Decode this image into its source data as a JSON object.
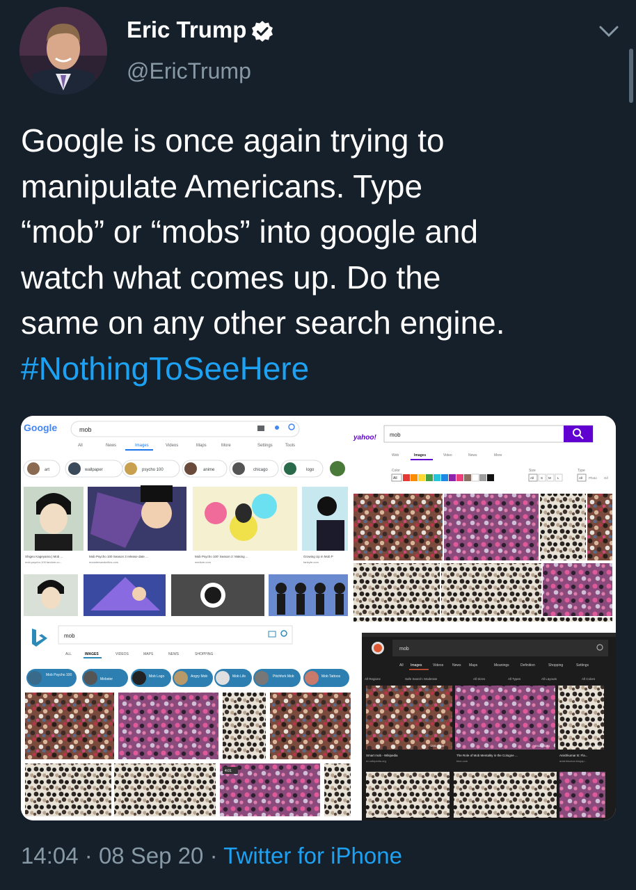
{
  "author": {
    "name": "Eric Trump",
    "handle": "@EricTrump",
    "verified": true
  },
  "tweet": {
    "lines": [
      "Google is once again trying to",
      "manipulate Americans. Type",
      "“mob” or “mobs” into google and",
      "watch what comes up. Do the",
      "same on any other search engine."
    ],
    "hashtag": "#NothingToSeeHere"
  },
  "meta": {
    "time": "14:04",
    "dot1": "·",
    "date": "08 Sep 20",
    "dot2": "·",
    "source": "Twitter for iPhone"
  },
  "screenshots": {
    "google": {
      "logo": "Google",
      "query": "mob",
      "tabs": [
        "All",
        "News",
        "Images",
        "Videos",
        "Maps",
        "More"
      ],
      "tools": [
        "Settings",
        "Tools"
      ],
      "chips": [
        "art",
        "wallpaper",
        "psycho 100",
        "anime",
        "chicago",
        "logo"
      ],
      "captions": [
        "Shigeo Kageyama | Mob ...",
        "Mob Psycho 100 Season 3 release date ...",
        "Mob Psycho 100' Season 2: Making ...",
        "Growing Up in Mob P"
      ],
      "domains": [
        "mob-psycho-100.fandom.co...",
        "monstersandcritics.com",
        "medium.com",
        "fanbyte.com"
      ]
    },
    "yahoo": {
      "logo": "yahoo!",
      "query": "mob",
      "tabs": [
        "Web",
        "Images",
        "Video",
        "News",
        "More"
      ],
      "filters": [
        "Color",
        "Size",
        "Type"
      ],
      "all": "All",
      "sizes": [
        "All",
        "S",
        "M",
        "L"
      ],
      "types": [
        "All",
        "Photo",
        "Gif"
      ]
    },
    "bing": {
      "query": "mob",
      "tabs": [
        "ALL",
        "IMAGES",
        "VIDEOS",
        "MAPS",
        "NEWS",
        "SHOPPING"
      ],
      "chips": [
        "Mob Psycho 100",
        "Mobster",
        "Mob Logo",
        "Angry Mob",
        "Mob Life",
        "Pitchfork Mob",
        "Mob Tattoos"
      ],
      "badge": "4:01"
    },
    "ddg": {
      "query": "mob",
      "tabs": [
        "All",
        "Images",
        "Videos",
        "News",
        "Maps",
        "Meanings",
        "Definition",
        "Shopping",
        "Settings"
      ],
      "filters": [
        "All Regions",
        "Safe Search: Moderate",
        "All Sizes",
        "All Types",
        "All Layouts",
        "All Colors"
      ],
      "captions": [
        "Smart mob - Wikipedia",
        "The Role of Mob Mentality in the Cologne ...",
        "Anishkumar B: Fla..."
      ],
      "domains": [
        "en.wikipedia.org",
        "time.com",
        "anishbkumar.blogsp..."
      ],
      "sizes": [
        "1200 × 900",
        "4912 × 3361",
        "1600 × 1600"
      ]
    }
  },
  "colors": {
    "background": "#16202b",
    "link": "#1da1f2",
    "muted": "#8899a6"
  }
}
